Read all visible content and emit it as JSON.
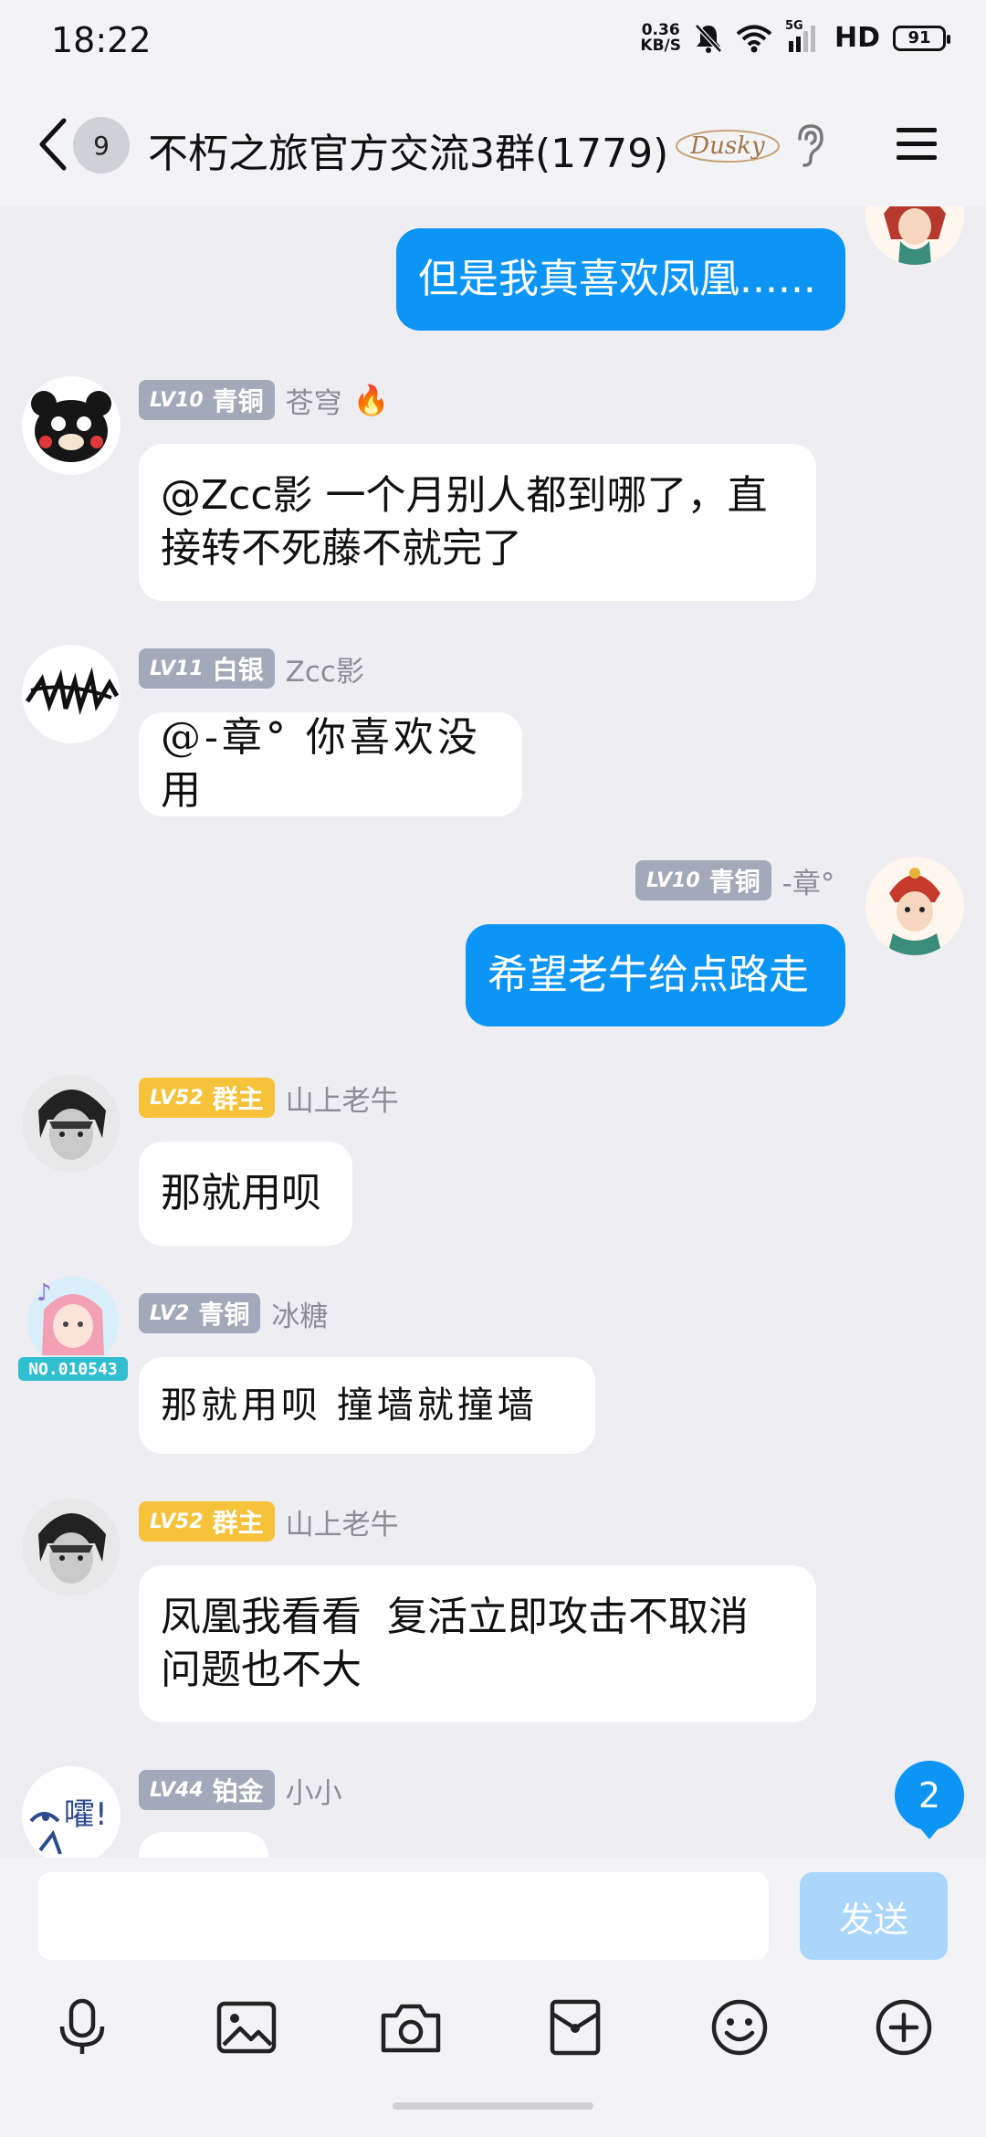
{
  "status": {
    "time": "18:22",
    "net_speed_value": "0.36",
    "net_speed_unit": "KB/S",
    "network": "5G",
    "hd": "HD",
    "battery": "91"
  },
  "header": {
    "unread_count": "9",
    "title": "不朽之旅官方交流3群(1779)",
    "logo_text": "Dusky"
  },
  "messages": [
    {
      "direction": "out",
      "text": "但是我真喜欢凤凰......"
    },
    {
      "direction": "in",
      "level": "LV10",
      "rank": "青铜",
      "nickname": "苍穹",
      "text_lines": [
        "@Zcc影 一个月别人都到哪了，直",
        "接转不死藤不就完了"
      ]
    },
    {
      "direction": "in",
      "level": "LV11",
      "rank": "白银",
      "nickname": "Zcc影",
      "text": "@-章° 你喜欢没用"
    },
    {
      "direction": "out",
      "level": "LV10",
      "rank": "青铜",
      "nickname": "-章°",
      "text": "希望老牛给点路走"
    },
    {
      "direction": "in",
      "level": "LV52",
      "rank": "群主",
      "nickname": "山上老牛",
      "text": "那就用呗"
    },
    {
      "direction": "in",
      "level": "LV2",
      "rank": "青铜",
      "nickname": "冰糖",
      "avatar_text": "NO.010543",
      "text": "那就用呗 撞墙就撞墙"
    },
    {
      "direction": "in",
      "level": "LV52",
      "rank": "群主",
      "nickname": "山上老牛",
      "text_lines": [
        "凤凰我看看  复活立即攻击不取消",
        "问题也不大"
      ]
    },
    {
      "direction": "in",
      "level": "LV44",
      "rank": "铂金",
      "nickname": "小小",
      "avatar_text": "嚯!"
    }
  ],
  "new_message_count": "2",
  "input": {
    "placeholder": "",
    "send_label": "发送"
  },
  "toolbar": {
    "icons": [
      "microphone-icon",
      "image-icon",
      "camera-icon",
      "red-packet-icon",
      "emoji-icon",
      "plus-icon"
    ]
  },
  "colors": {
    "accent": "#0C95F5",
    "background": "#EDEDF2",
    "level_badge": "#A2A9B8",
    "owner_badge": "#F5C23A"
  }
}
